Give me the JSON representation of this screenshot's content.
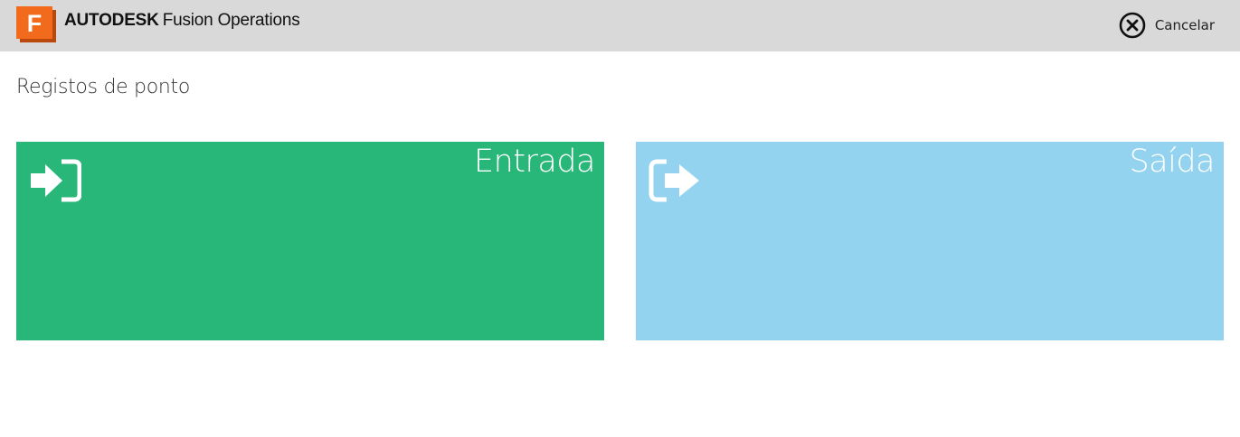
{
  "header": {
    "brand_bold": "AUTODESK",
    "brand_product": "Fusion Operations",
    "logo_letter": "F",
    "logo_icon": "fusion-logo",
    "cancel_label": "Cancelar",
    "cancel_icon": "close-circle-icon"
  },
  "main": {
    "title": "Registos de ponto",
    "tiles": [
      {
        "label": "Entrada",
        "icon": "sign-in-icon",
        "color": "#29b779"
      },
      {
        "label": "Saída",
        "icon": "sign-out-icon",
        "color": "#94d3f0"
      }
    ]
  },
  "colors": {
    "header_bg": "#d9d9d9",
    "logo_orange": "#f26b1d",
    "logo_dark_orange": "#b8480c"
  }
}
